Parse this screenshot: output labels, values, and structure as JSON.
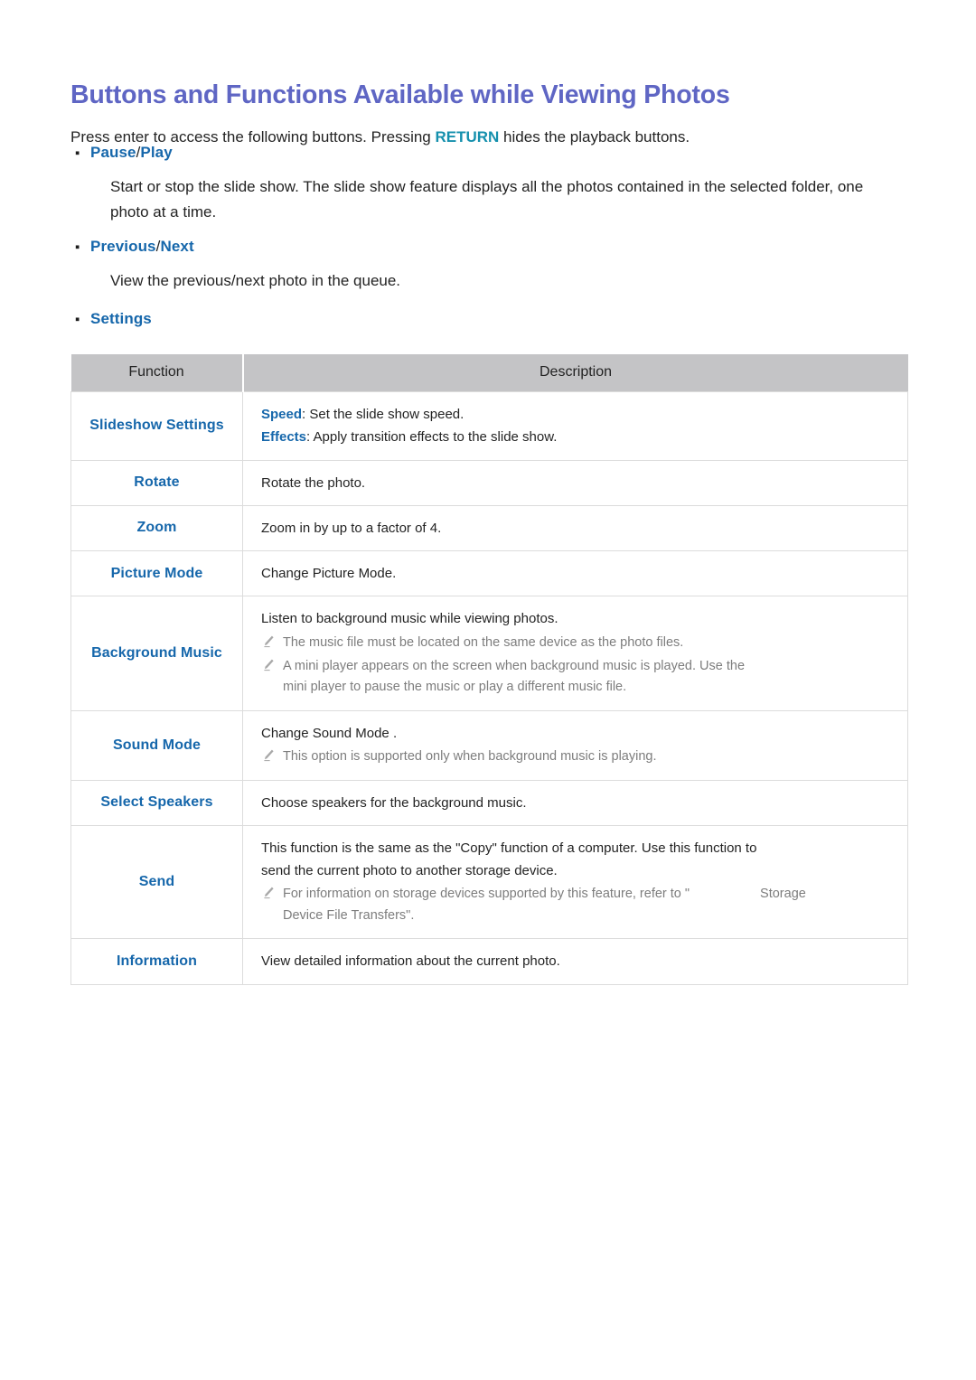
{
  "document": {
    "title": "Buttons and Functions Available while Viewing Photos",
    "intro": {
      "before": "Press enter to access the following buttons. Pressing ",
      "keyword": "RETURN",
      "after": " hides the playback buttons."
    }
  },
  "bullets": [
    {
      "label_a": "Pause",
      "separator": " / ",
      "label_b": "Play",
      "body": "Start or stop the slide show. The slide show feature displays all the photos contained in the selected folder, one photo at a time."
    },
    {
      "label_a": "Previous",
      "separator": " / ",
      "label_b": "Next",
      "body": "View the previous/next photo in the queue."
    },
    {
      "label_a": "Settings",
      "separator": "",
      "label_b": "",
      "body": ""
    }
  ],
  "table": {
    "headers": {
      "function": "Function",
      "description": "Description"
    },
    "rows": [
      {
        "function": "Slideshow Settings",
        "lines": [
          {
            "keyword": "Speed",
            "text": ": Set the slide show speed."
          },
          {
            "keyword": "Effects",
            "text": ": Apply transition effects to the slide show."
          }
        ],
        "notes": []
      },
      {
        "function": "Rotate",
        "lines": [
          {
            "keyword": "",
            "text": "Rotate the photo."
          }
        ],
        "notes": []
      },
      {
        "function": "Zoom",
        "lines": [
          {
            "keyword": "",
            "text": "Zoom in by up to a factor of 4."
          }
        ],
        "notes": []
      },
      {
        "function": "Picture Mode",
        "lines": [
          {
            "keyword": "",
            "text": "Change Picture Mode."
          }
        ],
        "notes": []
      },
      {
        "function": "Background Music",
        "lines": [
          {
            "keyword": "",
            "text": "Listen to background music while viewing photos."
          }
        ],
        "notes": [
          {
            "text": "The music file must be located on the same device as the photo files.",
            "continuation": ""
          },
          {
            "text": "A mini player appears on the screen when background music is played. Use the",
            "continuation": "mini player to pause the music or play a different music file."
          }
        ]
      },
      {
        "function": "Sound Mode",
        "lines": [
          {
            "keyword": "",
            "text": "Change Sound Mode ."
          }
        ],
        "notes": [
          {
            "text": "This option is supported only when background music is playing.",
            "continuation": ""
          }
        ]
      },
      {
        "function": "Select Speakers",
        "lines": [
          {
            "keyword": "",
            "text": "Choose speakers for the background music."
          }
        ],
        "notes": []
      },
      {
        "function": "Send",
        "lines": [
          {
            "keyword": "",
            "text": "This function is the same as the \"Copy\" function of a computer. Use this function to"
          },
          {
            "keyword": "",
            "text": "send the current photo to another storage device."
          }
        ],
        "notes": [
          {
            "text": "For information on storage devices supported by this feature, refer to \"",
            "continuation": "Device File Transfers\".",
            "trailing": "Storage"
          }
        ]
      },
      {
        "function": "Information",
        "lines": [
          {
            "keyword": "",
            "text": "View detailed information about the current photo."
          }
        ],
        "notes": []
      }
    ]
  },
  "colors": {
    "title": "#5f66c4",
    "link_blue": "#1667ab",
    "keyword_teal": "#1590ad",
    "body_text": "#232323",
    "note_text": "#7d7d7d",
    "table_header_bg": "#c4c4c6",
    "table_border": "#dcdcdc"
  }
}
